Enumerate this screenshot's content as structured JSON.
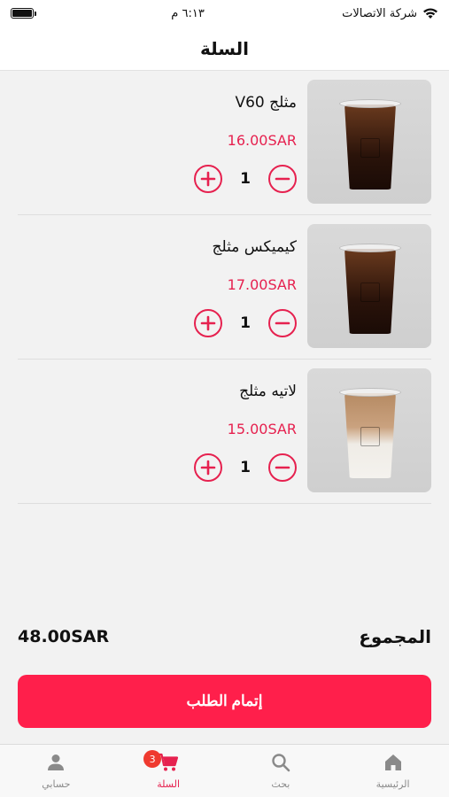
{
  "status_bar": {
    "carrier": "شركة الاتصالات",
    "time": "٦:١٣ م",
    "battery_level": 1.0
  },
  "header": {
    "title": "السلة"
  },
  "cart": {
    "items": [
      {
        "name": "مثلج V60",
        "price": "16.00SAR",
        "quantity": "1",
        "image": "iced-coffee-dark"
      },
      {
        "name": "كيميكس مثلج",
        "price": "17.00SAR",
        "quantity": "1",
        "image": "iced-coffee-dark"
      },
      {
        "name": "لاتيه مثلج",
        "price": "15.00SAR",
        "quantity": "1",
        "image": "iced-latte"
      }
    ]
  },
  "summary": {
    "total_label": "المجموع",
    "total_amount": "48.00SAR"
  },
  "checkout": {
    "label": "إتمام الطلب"
  },
  "tab_bar": {
    "tabs": [
      {
        "label": "حسابي",
        "icon": "user-icon"
      },
      {
        "label": "السلة",
        "icon": "cart-icon",
        "badge": "3",
        "active": true
      },
      {
        "label": "بحث",
        "icon": "search-icon"
      },
      {
        "label": "الرئيسية",
        "icon": "home-icon"
      }
    ]
  },
  "colors": {
    "accent": "#e6214f",
    "checkout_button": "#ff1f4b",
    "badge": "#ef3a2f",
    "background": "#f2f2f2"
  }
}
